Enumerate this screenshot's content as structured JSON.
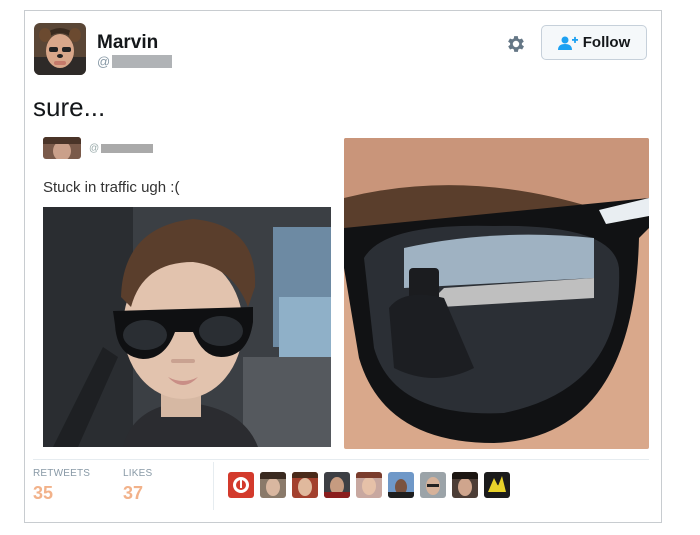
{
  "user": {
    "name": "Marvin",
    "handle_prefix": "@"
  },
  "actions": {
    "follow_label": "Follow"
  },
  "tweet": {
    "text": "sure..."
  },
  "quoted": {
    "handle_prefix": "@",
    "text": "Stuck in traffic ugh :("
  },
  "stats": {
    "retweets_label": "RETWEETS",
    "retweets_count": "35",
    "likes_label": "LIKES",
    "likes_count": "37"
  },
  "likers": [
    "avatar-1",
    "avatar-2",
    "avatar-3",
    "avatar-4",
    "avatar-5",
    "avatar-6",
    "avatar-7",
    "avatar-8",
    "avatar-9"
  ],
  "colors": {
    "accent": "#1da1f2",
    "stat_number": "#f2b28a",
    "text": "#14171a",
    "muted": "#8899a6"
  }
}
